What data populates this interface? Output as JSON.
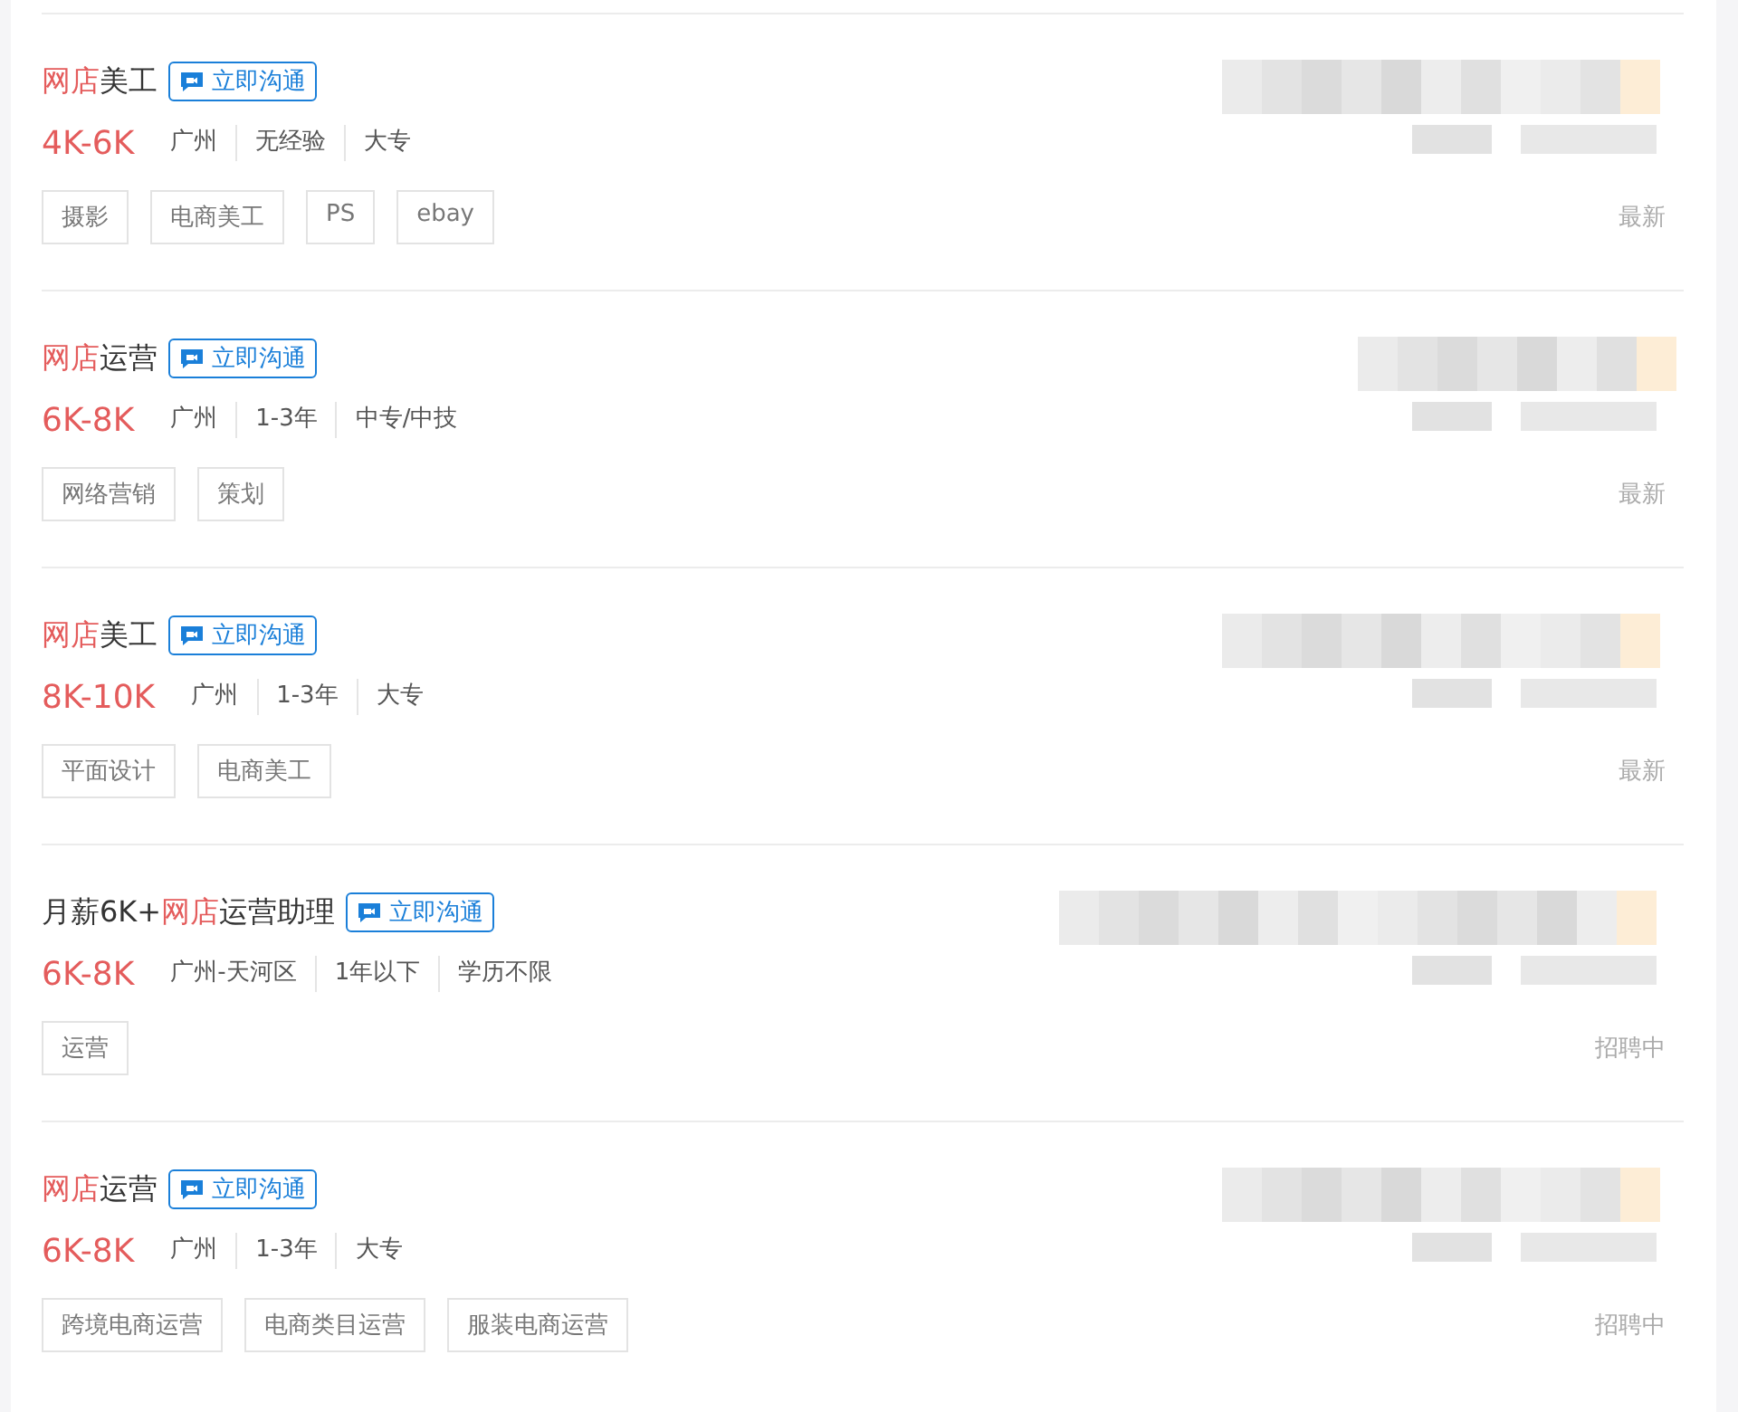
{
  "jobs": [
    {
      "title_parts": [
        {
          "text": "网店",
          "highlight": true
        },
        {
          "text": "美工",
          "highlight": false
        }
      ],
      "chat_button": "立即沟通",
      "salary": "4K-6K",
      "details": [
        "广州",
        "无经验",
        "大专"
      ],
      "tags": [
        "摄影",
        "电商美工",
        "PS",
        "ebay"
      ],
      "status": "最新"
    },
    {
      "title_parts": [
        {
          "text": "网店",
          "highlight": true
        },
        {
          "text": "运营",
          "highlight": false
        }
      ],
      "chat_button": "立即沟通",
      "salary": "6K-8K",
      "details": [
        "广州",
        "1-3年",
        "中专/中技"
      ],
      "tags": [
        "网络营销",
        "策划"
      ],
      "status": "最新"
    },
    {
      "title_parts": [
        {
          "text": "网店",
          "highlight": true
        },
        {
          "text": "美工",
          "highlight": false
        }
      ],
      "chat_button": "立即沟通",
      "salary": "8K-10K",
      "details": [
        "广州",
        "1-3年",
        "大专"
      ],
      "tags": [
        "平面设计",
        "电商美工"
      ],
      "status": "最新"
    },
    {
      "title_parts": [
        {
          "text": "月薪6K+",
          "highlight": false
        },
        {
          "text": "网店",
          "highlight": true
        },
        {
          "text": "运营助理",
          "highlight": false
        }
      ],
      "chat_button": "立即沟通",
      "salary": "6K-8K",
      "details": [
        "广州-天河区",
        "1年以下",
        "学历不限"
      ],
      "tags": [
        "运营"
      ],
      "status": "招聘中"
    },
    {
      "title_parts": [
        {
          "text": "网店",
          "highlight": true
        },
        {
          "text": "运营",
          "highlight": false
        }
      ],
      "chat_button": "立即沟通",
      "salary": "6K-8K",
      "details": [
        "广州",
        "1-3年",
        "大专"
      ],
      "tags": [
        "跨境电商运营",
        "电商类目运营",
        "服装电商运营"
      ],
      "status": "招聘中"
    }
  ]
}
